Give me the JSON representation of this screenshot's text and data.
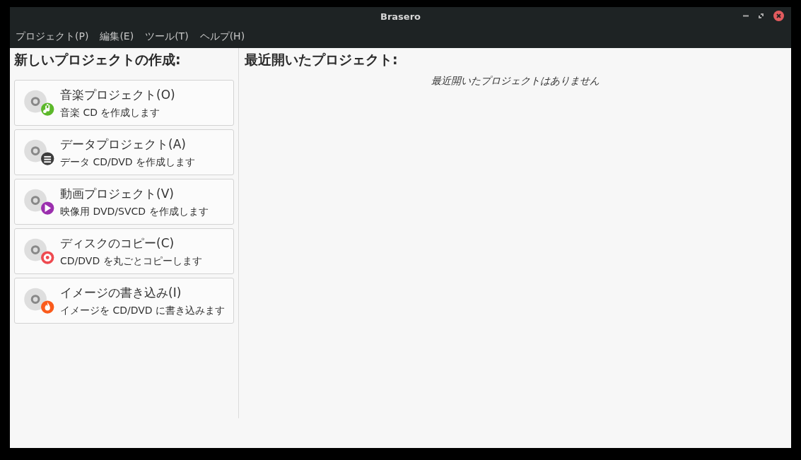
{
  "window": {
    "title": "Brasero"
  },
  "menu": [
    "プロジェクト(P)",
    "編集(E)",
    "ツール(T)",
    "ヘルプ(H)"
  ],
  "new_project": {
    "heading": "新しいプロジェクトの作成:",
    "items": [
      {
        "kind": "music",
        "title": "音楽プロジェクト(O)",
        "description": "音楽 CD を作成します"
      },
      {
        "kind": "data",
        "title": "データプロジェクト(A)",
        "description": "データ CD/DVD を作成します"
      },
      {
        "kind": "video",
        "title": "動画プロジェクト(V)",
        "description": "映像用 DVD/SVCD を作成します"
      },
      {
        "kind": "copy",
        "title": "ディスクのコピー(C)",
        "description": "CD/DVD を丸ごとコピーします"
      },
      {
        "kind": "burn",
        "title": "イメージの書き込み(I)",
        "description": "イメージを CD/DVD に書き込みます"
      }
    ]
  },
  "recent": {
    "heading": "最近開いたプロジェクト:",
    "empty_message": "最近開いたプロジェクトはありません"
  }
}
